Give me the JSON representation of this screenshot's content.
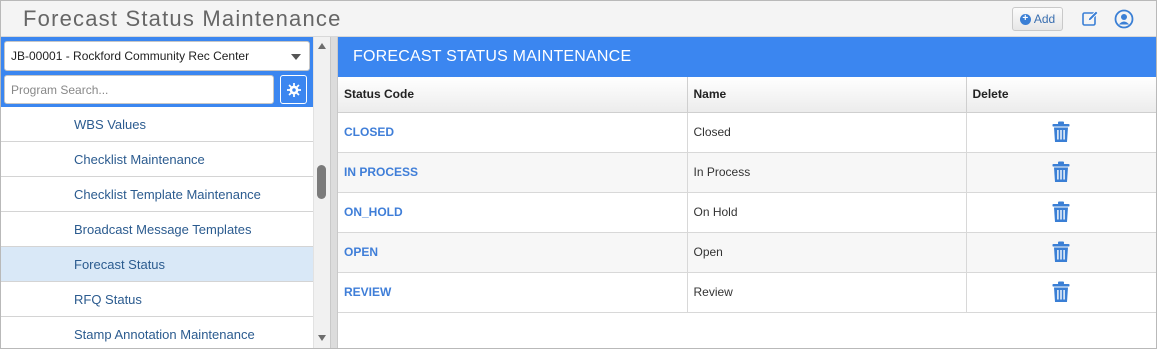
{
  "app": {
    "title": "Forecast Status Maintenance",
    "add_label": "Add"
  },
  "sidebar": {
    "project_selected": "JB-00001 - Rockford Community Rec Center",
    "search_placeholder": "Program Search...",
    "items": [
      {
        "label": "WBS Values"
      },
      {
        "label": "Checklist Maintenance"
      },
      {
        "label": "Checklist Template Maintenance"
      },
      {
        "label": "Broadcast Message Templates"
      },
      {
        "label": "Forecast Status",
        "active": true
      },
      {
        "label": "RFQ Status"
      },
      {
        "label": "Stamp Annotation Maintenance"
      }
    ]
  },
  "main": {
    "header": "FORECAST STATUS MAINTENANCE",
    "columns": [
      "Status Code",
      "Name",
      "Delete"
    ],
    "rows": [
      {
        "code": "CLOSED",
        "name": "Closed"
      },
      {
        "code": "IN PROCESS",
        "name": "In Process"
      },
      {
        "code": "ON_HOLD",
        "name": "On Hold"
      },
      {
        "code": "OPEN",
        "name": "Open"
      },
      {
        "code": "REVIEW",
        "name": "Review"
      }
    ]
  },
  "colors": {
    "accent": "#3b86f0",
    "link": "#3f7ed8",
    "nav_text": "#2b5b8f",
    "active_row": "#d9e8f7"
  },
  "icons": [
    "plus-circle-icon",
    "edit-icon",
    "user-icon",
    "chevron-down-icon",
    "gear-icon",
    "trash-icon"
  ]
}
